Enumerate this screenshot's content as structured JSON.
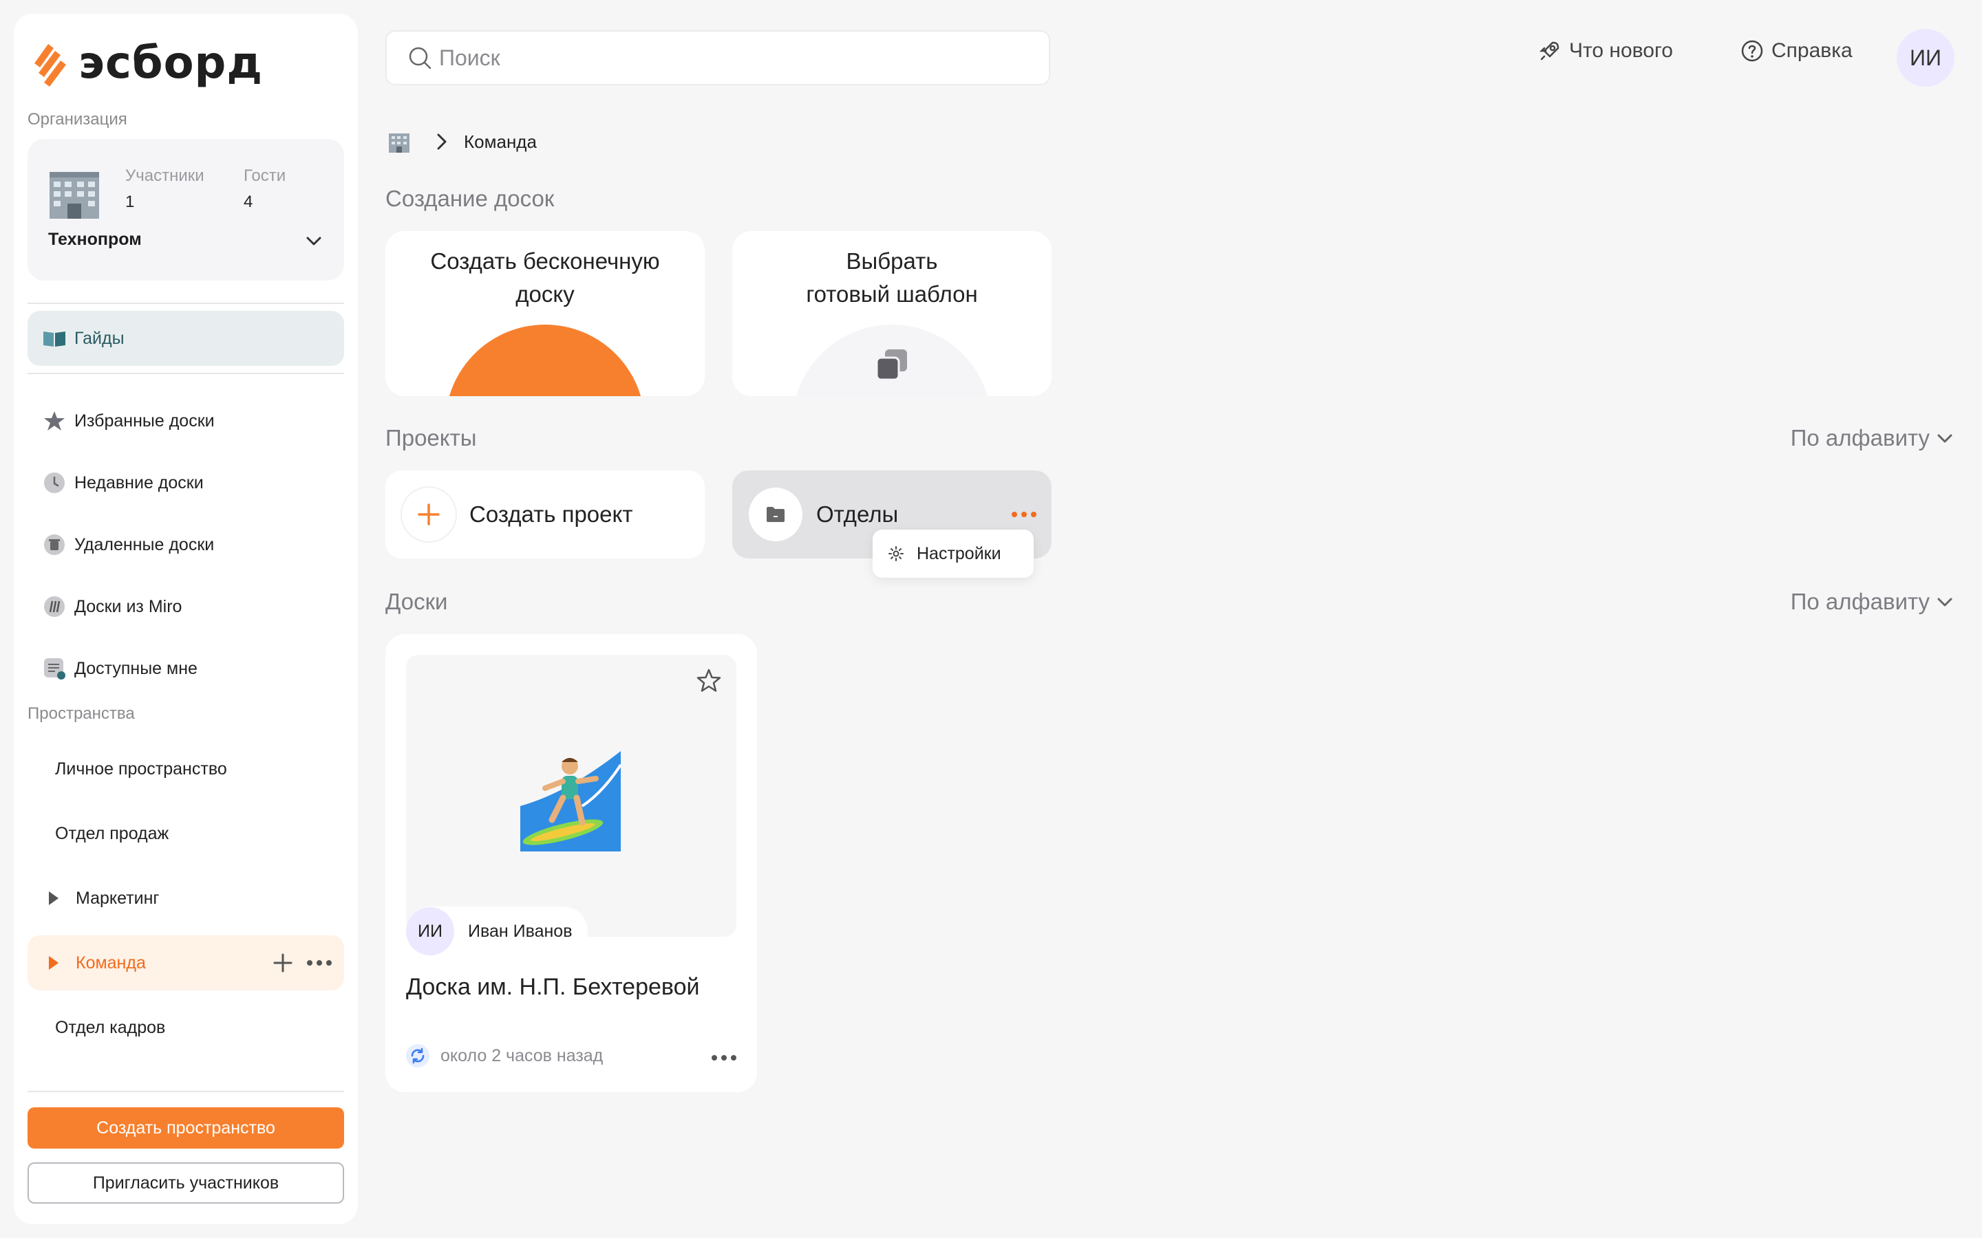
{
  "brand": {
    "name": "эсборд",
    "accent": "#f7802e"
  },
  "sidebar": {
    "org_label": "Организация",
    "org": {
      "name": "Технопром",
      "members_label": "Участники",
      "members_count": "1",
      "guests_label": "Гости",
      "guests_count": "4"
    },
    "nav": {
      "guides": "Гайды",
      "favorites": "Избранные доски",
      "recent": "Недавние доски",
      "deleted": "Удаленные доски",
      "miro": "Доски из Miro",
      "shared": "Доступные мне"
    },
    "spaces_label": "Пространства",
    "spaces": {
      "personal": "Личное пространство",
      "sales": "Отдел продаж",
      "marketing": "Маркетинг",
      "team": "Команда",
      "hr": "Отдел кадров"
    },
    "create_space": "Создать пространство",
    "invite": "Пригласить участников"
  },
  "topbar": {
    "search_placeholder": "Поиск",
    "whats_new": "Что нового",
    "help": "Справка",
    "avatar_initials": "ИИ"
  },
  "breadcrumb": {
    "current": "Команда"
  },
  "create_section": {
    "title": "Создание досок",
    "infinite_line1": "Создать бесконечную",
    "infinite_line2": "доску",
    "template_line1": "Выбрать",
    "template_line2": "готовый шаблон"
  },
  "projects": {
    "title": "Проекты",
    "sort": "По алфавиту",
    "create": "Создать проект",
    "folder": "Отделы",
    "popup_settings": "Настройки"
  },
  "boards": {
    "title": "Доски",
    "sort": "По алфавиту",
    "items": [
      {
        "title": "Доска им. Н.П. Бехтеревой",
        "owner_initials": "ИИ",
        "owner": "Иван Иванов",
        "updated": "около 2 часов назад"
      }
    ]
  }
}
